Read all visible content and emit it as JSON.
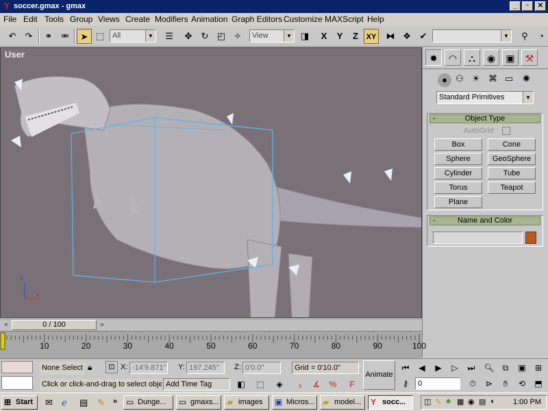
{
  "window": {
    "title": "soccer.gmax - gmax",
    "min": "_",
    "max": "▫",
    "close": "✕"
  },
  "menu": [
    "File",
    "Edit",
    "Tools",
    "Group",
    "Views",
    "Create",
    "Modifiers",
    "Animation",
    "Graph Editors",
    "Customize",
    "MAXScript",
    "Help"
  ],
  "toolbar": {
    "selection_filter": "All",
    "ref_coord": "View",
    "axis_x": "X",
    "axis_y": "Y",
    "axis_z": "Z",
    "axis_xy": "XY",
    "named_selection": ""
  },
  "viewport": {
    "label": "User",
    "axis_z": "z",
    "axis_y": "y",
    "axis_x": "x"
  },
  "command_panel": {
    "category_dropdown": "Standard Primitives",
    "object_type": {
      "header": "Object Type",
      "autogrid": "AutoGrid",
      "buttons": [
        "Box",
        "Cone",
        "Sphere",
        "GeoSphere",
        "Cylinder",
        "Tube",
        "Torus",
        "Teapot",
        "Plane"
      ]
    },
    "name_and_color": {
      "header": "Name and Color",
      "name_value": "",
      "color": "#b85a1c"
    },
    "collapse_symbol": "-"
  },
  "time_slider": {
    "label": "0 / 100",
    "position": 0
  },
  "timeline": {
    "ticks": [
      "10",
      "20",
      "30",
      "40",
      "50",
      "60",
      "70",
      "80",
      "90",
      "100"
    ]
  },
  "status": {
    "selection": "None Select",
    "prompt": "Click or click-and-drag to select obje",
    "x_label": "X:",
    "x_value": "-14'9.871\"",
    "y_label": "Y:",
    "y_value": "197.245\"",
    "z_label": "Z:",
    "z_value": "0'0.0\"",
    "grid": "Grid = 0'10.0\"",
    "add_time_tag": "Add Time Tag",
    "animate": "Animate",
    "frame_value": "0"
  },
  "taskbar": {
    "start": "Start",
    "tasks": [
      "Dunge...",
      "gmaxs...",
      "images",
      "Micros...",
      "model...",
      "socc..."
    ],
    "clock": "1:00 PM"
  }
}
